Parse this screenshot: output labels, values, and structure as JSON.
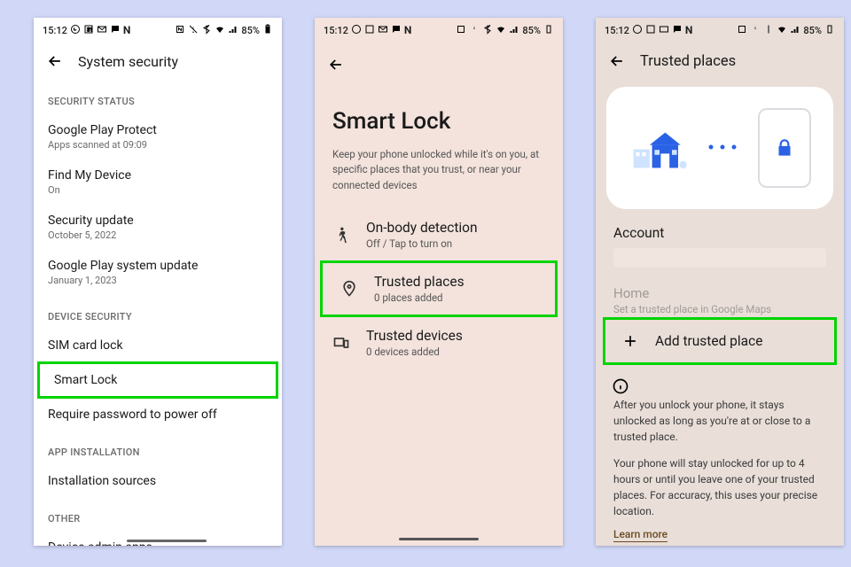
{
  "status": {
    "time": "15:12",
    "battery": "85%"
  },
  "screenA": {
    "title": "System security",
    "sect1": "SECURITY STATUS",
    "r1": {
      "t": "Google Play Protect",
      "s": "Apps scanned at 09:09"
    },
    "r2": {
      "t": "Find My Device",
      "s": "On"
    },
    "r3": {
      "t": "Security update",
      "s": "October 5, 2022"
    },
    "r4": {
      "t": "Google Play system update",
      "s": "January 1, 2023"
    },
    "sect2": "DEVICE SECURITY",
    "r5": {
      "t": "SIM card lock"
    },
    "r6": {
      "t": "Smart Lock"
    },
    "r7": {
      "t": "Require password to power off"
    },
    "sect3": "APP INSTALLATION",
    "r8": {
      "t": "Installation sources"
    },
    "sect4": "OTHER",
    "r9": {
      "t": "Device admin apps"
    }
  },
  "screenB": {
    "title": "Smart Lock",
    "desc": "Keep your phone unlocked while it's on you, at specific places that you trust, or near your connected devices",
    "r1": {
      "t": "On-body detection",
      "s": "Off / Tap to turn on"
    },
    "r2": {
      "t": "Trusted places",
      "s": "0 places added"
    },
    "r3": {
      "t": "Trusted devices",
      "s": "0 devices added"
    }
  },
  "screenC": {
    "title": "Trusted places",
    "acct": "Account",
    "home": {
      "t": "Home",
      "s": "Set a trusted place in Google Maps"
    },
    "add": "Add trusted place",
    "info1": "After you unlock your phone, it stays unlocked as long as you're at or close to a trusted place.",
    "info2": "Your phone will stay unlocked for up to 4 hours or until you leave one of your trusted places. For accuracy, this uses your precise location.",
    "learn": "Learn more"
  }
}
